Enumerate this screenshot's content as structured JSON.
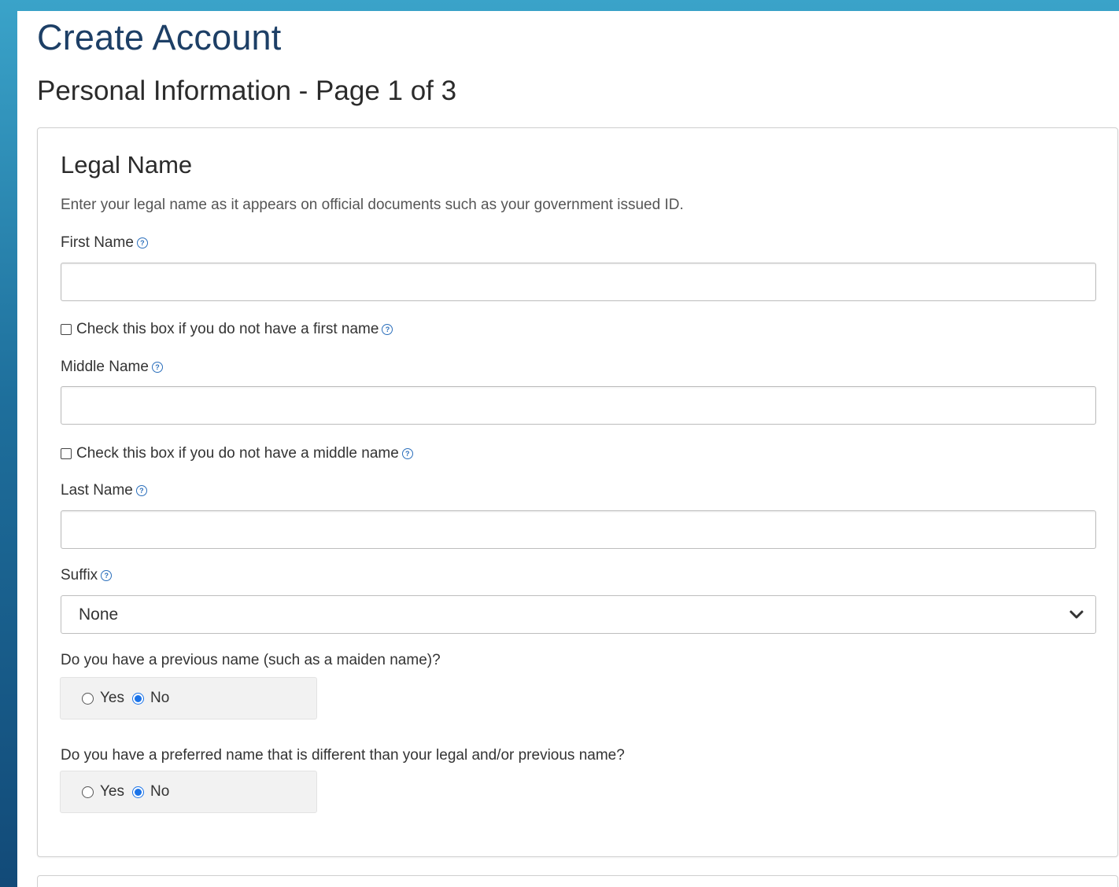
{
  "header": {
    "title": "Create Account",
    "subtitle": "Personal Information - Page 1 of 3"
  },
  "legal_name": {
    "title": "Legal Name",
    "instructions": "Enter your legal name as it appears on official documents such as your government issued ID.",
    "first_name": {
      "label": "First Name",
      "value": ""
    },
    "no_first_name": {
      "label": "Check this box if you do not have a first name",
      "checked": false
    },
    "middle_name": {
      "label": "Middle Name",
      "value": ""
    },
    "no_middle_name": {
      "label": "Check this box if you do not have a middle name",
      "checked": false
    },
    "last_name": {
      "label": "Last Name",
      "value": ""
    },
    "suffix": {
      "label": "Suffix",
      "selected": "None"
    },
    "previous_name": {
      "question": "Do you have a previous name (such as a maiden name)?",
      "options": [
        "Yes",
        "No"
      ],
      "selected": "No"
    },
    "preferred_name": {
      "question": "Do you have a preferred name that is different than your legal and/or previous name?",
      "options": [
        "Yes",
        "No"
      ],
      "selected": "No"
    }
  },
  "icons": {
    "help": "question-circle-icon",
    "select_caret": "chevron-down-icon"
  },
  "colors": {
    "title": "#1d3f66",
    "accent": "#1a73e8",
    "help_icon": "#2a6ebb",
    "radio_group_bg": "#f2f2f2"
  }
}
